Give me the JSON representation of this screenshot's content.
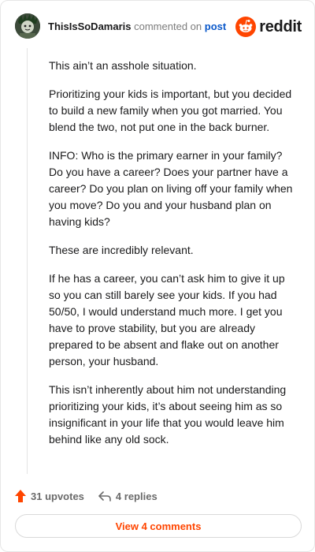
{
  "header": {
    "username": "ThisIsSoDamaris",
    "commented_on": "commented on",
    "post_link": "post",
    "brand": "reddit",
    "avatar_icon": "user-avatar",
    "logo_icon": "reddit-snoo-icon"
  },
  "comment": {
    "paragraphs": [
      "This ain’t an asshole situation.",
      "Prioritizing your kids is important, but you decided to build a new family when you got married. You blend the two, not put one in the back burner.",
      "INFO: Who is the primary earner in your family? Do you have a career? Does your partner have a career? Do you plan on living off your family when you move? Do you and your husband plan on having kids?",
      "These are incredibly relevant.",
      "If he has a career, you can’t ask him to give it up so you can still barely see your kids. If you had 50/50, I would understand much more. I get you have to prove stability, but you are already prepared to be absent and flake out on another person, your husband.",
      "This isn’t inherently about him not understanding prioritizing your kids, it’s about seeing him as so insignificant in your life that you would leave him behind like any old sock."
    ]
  },
  "actions": {
    "upvotes": "31 upvotes",
    "replies": "4 replies"
  },
  "footer": {
    "view_comments": "View 4 comments"
  },
  "colors": {
    "brand_orange": "#ff4500",
    "link_blue": "#0a58ca",
    "muted_text": "#7c7c7c"
  }
}
